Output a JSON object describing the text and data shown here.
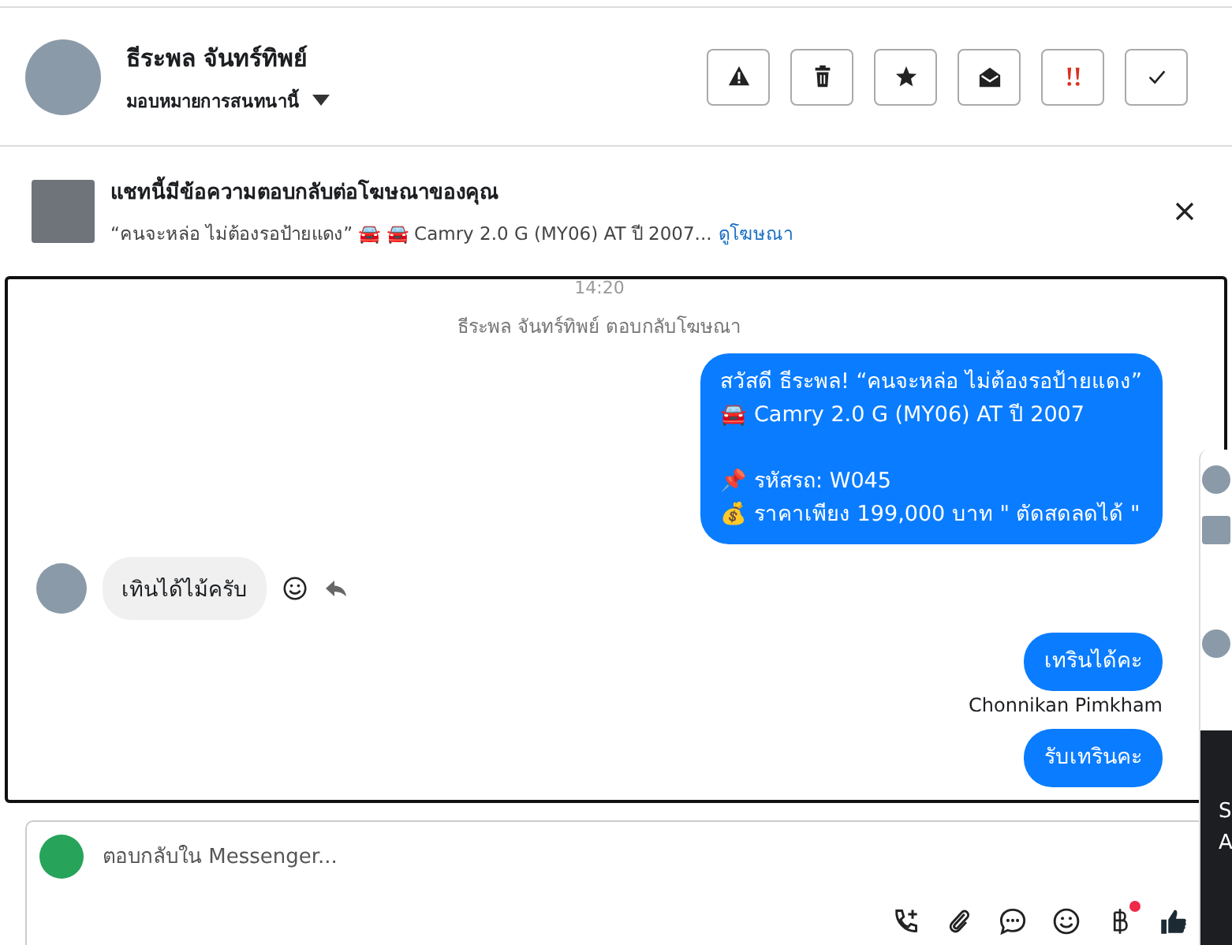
{
  "header": {
    "name": "ธีระพล จันทร์ทิพย์",
    "assign_label": "มอบหมายการสนทนานี้",
    "actions": [
      {
        "kind": "warning"
      },
      {
        "kind": "trash"
      },
      {
        "kind": "star"
      },
      {
        "kind": "envelope"
      },
      {
        "kind": "urgent"
      },
      {
        "kind": "check"
      }
    ]
  },
  "ad_banner": {
    "title": "แชทนี้มีข้อความตอบกลับต่อโฆษณาของคุณ",
    "snippet": "“คนจะหล่อ ไม่ต้องรอป้ายแดง” 🚘 🚘 Camry 2.0 G (MY06) AT ปี 2007...",
    "link": "ดูโฆษณา"
  },
  "messages": [
    {
      "kind": "timestamp",
      "text": "14:20"
    },
    {
      "kind": "system",
      "text": "ธีระพล จันทร์ทิพย์ ตอบกลับโฆษณา"
    },
    {
      "kind": "outgoing",
      "text": "สวัสดี ธีระพล! “คนจะหล่อ ไม่ต้องรอป้ายแดง”\n🚘 Camry 2.0 G (MY06) AT ปี 2007\n\n📌 รหัสรถ: W045\n💰 ราคาเพียง 199,000 บาท \" ตัดสดลดได้ \""
    },
    {
      "kind": "incoming",
      "text": "เทินได้ไม้ครับ"
    },
    {
      "kind": "outgoing",
      "text": "เทรินได้คะ"
    },
    {
      "kind": "sender",
      "text": "Chonnikan Pimkham"
    },
    {
      "kind": "outgoing",
      "text": "รับเทรินคะ"
    }
  ],
  "side_panel": {
    "lines": [
      "S",
      "A"
    ]
  },
  "composer": {
    "placeholder": "ตอบกลับใน Messenger...",
    "tools": [
      {
        "kind": "call",
        "badge": false
      },
      {
        "kind": "attach",
        "badge": false
      },
      {
        "kind": "bubble",
        "badge": false
      },
      {
        "kind": "emoji",
        "badge": false
      },
      {
        "kind": "baht",
        "badge": true
      },
      {
        "kind": "like",
        "badge": false
      }
    ]
  }
}
